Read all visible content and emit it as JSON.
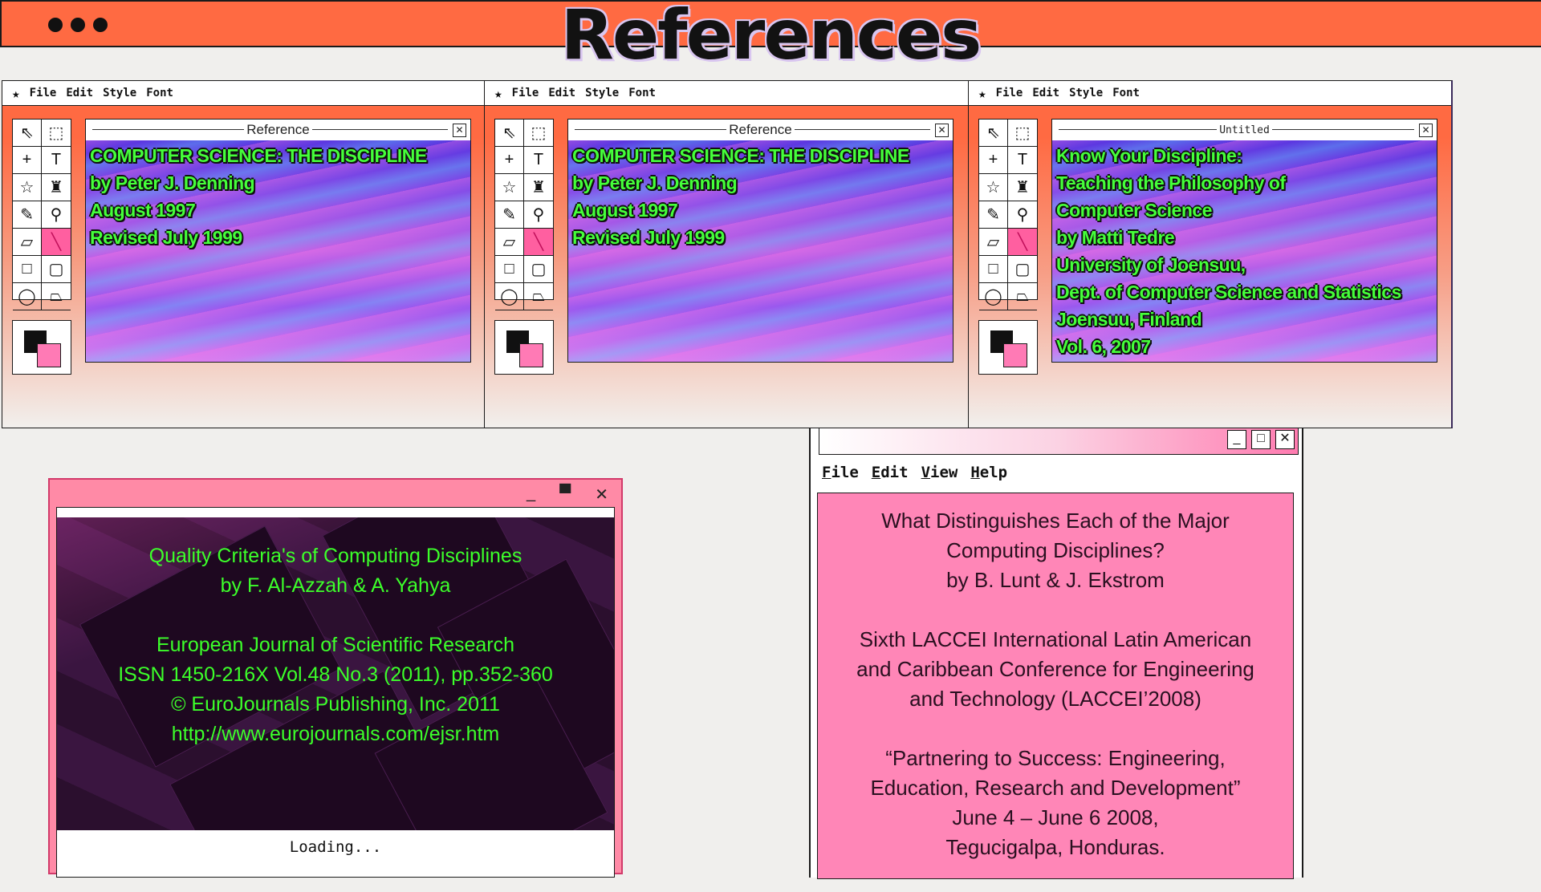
{
  "header": {
    "title": "References"
  },
  "paint_menu": [
    "File",
    "Edit",
    "Style",
    "Font"
  ],
  "paint_windows": [
    {
      "canvas_title": "Reference",
      "lines": [
        "COMPUTER SCIENCE: THE DISCIPLINE",
        "by Peter J. Denning",
        "August 1997",
        "Revised July 1999"
      ]
    },
    {
      "canvas_title": "Reference",
      "lines": [
        "COMPUTER SCIENCE: THE DISCIPLINE",
        "by Peter J. Denning",
        "August 1997",
        "Revised July 1999"
      ]
    },
    {
      "canvas_title": "Untitled",
      "lines": [
        "Know Your Discipline:",
        "Teaching the Philosophy of",
        "Computer Science",
        "by Matti Tedre",
        "University of Joensuu,",
        "Dept. of Computer Science and Statistics",
        " Joensuu, Finland",
        "Vol. 6, 2007"
      ]
    }
  ],
  "loading_window": {
    "lines": [
      "Quality Criteria's of Computing Disciplines",
      "by F. Al-Azzah & A. Yahya",
      "",
      "European Journal of Scientific Research",
      "ISSN 1450-216X Vol.48 No.3 (2011), pp.352-360",
      "© EuroJournals Publishing, Inc. 2011",
      "http://www.eurojournals.com/ejsr.htm"
    ],
    "status": "Loading..."
  },
  "note_window": {
    "menu": [
      "File",
      "Edit",
      "View",
      "Help"
    ],
    "paragraphs": [
      "What Distinguishes Each of the Major Computing Disciplines? by B. Lunt & J. Ekstrom",
      "Sixth LACCEI International Latin American and Caribbean Conference for Engineering and Technology (LACCEI’2008)",
      "“Partnering to Success: Engineering, Education, Research and Development” June 4 – June 6 2008, Tegucigalpa, Honduras."
    ],
    "lines": [
      [
        "What Distinguishes Each of the Major",
        "Computing Disciplines?",
        "by B. Lunt & J. Ekstrom"
      ],
      [
        "Sixth LACCEI International Latin American",
        "and Caribbean Conference for Engineering",
        "and Technology (LACCEI’2008)"
      ],
      [
        "“Partnering to Success: Engineering,",
        "Education, Research and Development”",
        "June 4 – June 6 2008,",
        "Tegucigalpa, Honduras."
      ]
    ]
  },
  "colors": {
    "header_bg": "#ff6a42",
    "pink": "#ff86b7",
    "green_text": "#45ff3a"
  }
}
